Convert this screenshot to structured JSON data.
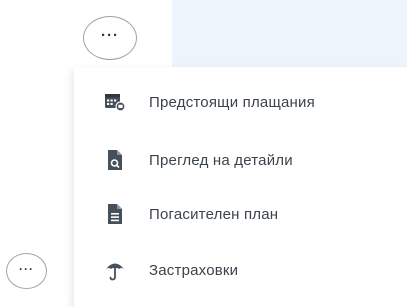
{
  "more_button": {
    "label": "···"
  },
  "menu": {
    "items": [
      {
        "label": "Предстоящи плащания",
        "icon": "calendar-payment-icon"
      },
      {
        "label": "Преглед на детайли",
        "icon": "document-detail-icon"
      },
      {
        "label": "Погасителен план",
        "icon": "document-lines-icon"
      },
      {
        "label": "Застраховки",
        "icon": "umbrella-icon"
      }
    ]
  },
  "colors": {
    "icon": "#46505a",
    "text": "#3b444d",
    "header_band": "#eef4fb"
  }
}
